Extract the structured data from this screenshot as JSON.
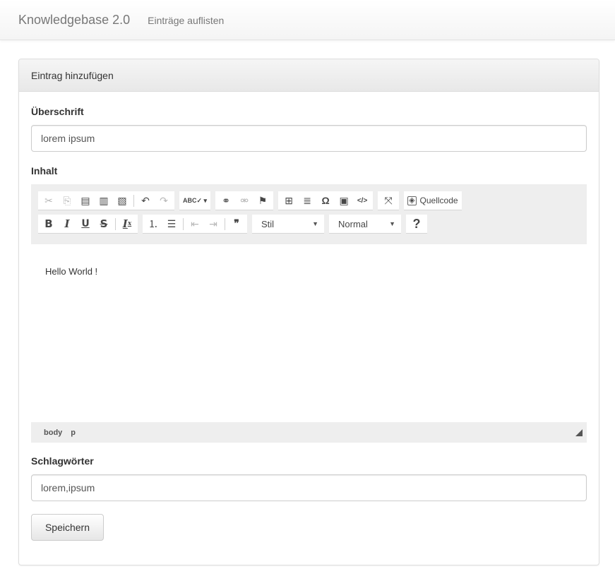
{
  "navbar": {
    "brand": "Knowledgebase 2.0",
    "link_list": "Einträge auflisten"
  },
  "panel": {
    "heading": "Eintrag hinzufügen"
  },
  "form": {
    "title_label": "Überschrift",
    "title_value": "lorem ipsum",
    "content_label": "Inhalt",
    "tags_label": "Schlagwörter",
    "tags_value": "lorem,ipsum",
    "save_label": "Speichern"
  },
  "editor": {
    "toolbar_row1": [
      {
        "name": "cut-icon",
        "glyph": "✂",
        "disabled": true
      },
      {
        "name": "copy-icon",
        "glyph": "⎘",
        "disabled": true
      },
      {
        "name": "paste-icon",
        "glyph": "📋",
        "disabled": false
      },
      {
        "name": "paste-text-icon",
        "glyph": "📋",
        "disabled": false
      },
      {
        "name": "paste-word-icon",
        "glyph": "📋",
        "disabled": false
      },
      {
        "name": "undo-icon",
        "glyph": "↶",
        "disabled": false
      },
      {
        "name": "redo-icon",
        "glyph": "↷",
        "disabled": true
      },
      {
        "name": "spellcheck-icon",
        "glyph": "ABC",
        "disabled": false
      },
      {
        "name": "link-icon",
        "glyph": "🔗",
        "disabled": false
      },
      {
        "name": "unlink-icon",
        "glyph": "🔗",
        "disabled": true
      },
      {
        "name": "anchor-flag-icon",
        "glyph": "⚑",
        "disabled": false
      },
      {
        "name": "table-icon",
        "glyph": "▦",
        "disabled": false
      },
      {
        "name": "horizontal-line-icon",
        "glyph": "≣",
        "disabled": false
      },
      {
        "name": "special-char-icon",
        "glyph": "Ω",
        "disabled": false
      },
      {
        "name": "image-icon",
        "glyph": "▣",
        "disabled": false
      },
      {
        "name": "code-snippet-icon",
        "glyph": "</>",
        "disabled": false
      },
      {
        "name": "maximize-icon",
        "glyph": "⛶",
        "disabled": false
      }
    ],
    "source_label": "Quellcode",
    "format_buttons": {
      "bold": "B",
      "italic": "I",
      "underline": "U",
      "strike": "S",
      "removeformat": "Ix"
    },
    "style_combo": "Stil",
    "format_combo": "Normal",
    "help_glyph": "?",
    "blockquote_glyph": "99",
    "content_text": "Hello World !",
    "statusbar_path": [
      "body",
      "p"
    ]
  }
}
